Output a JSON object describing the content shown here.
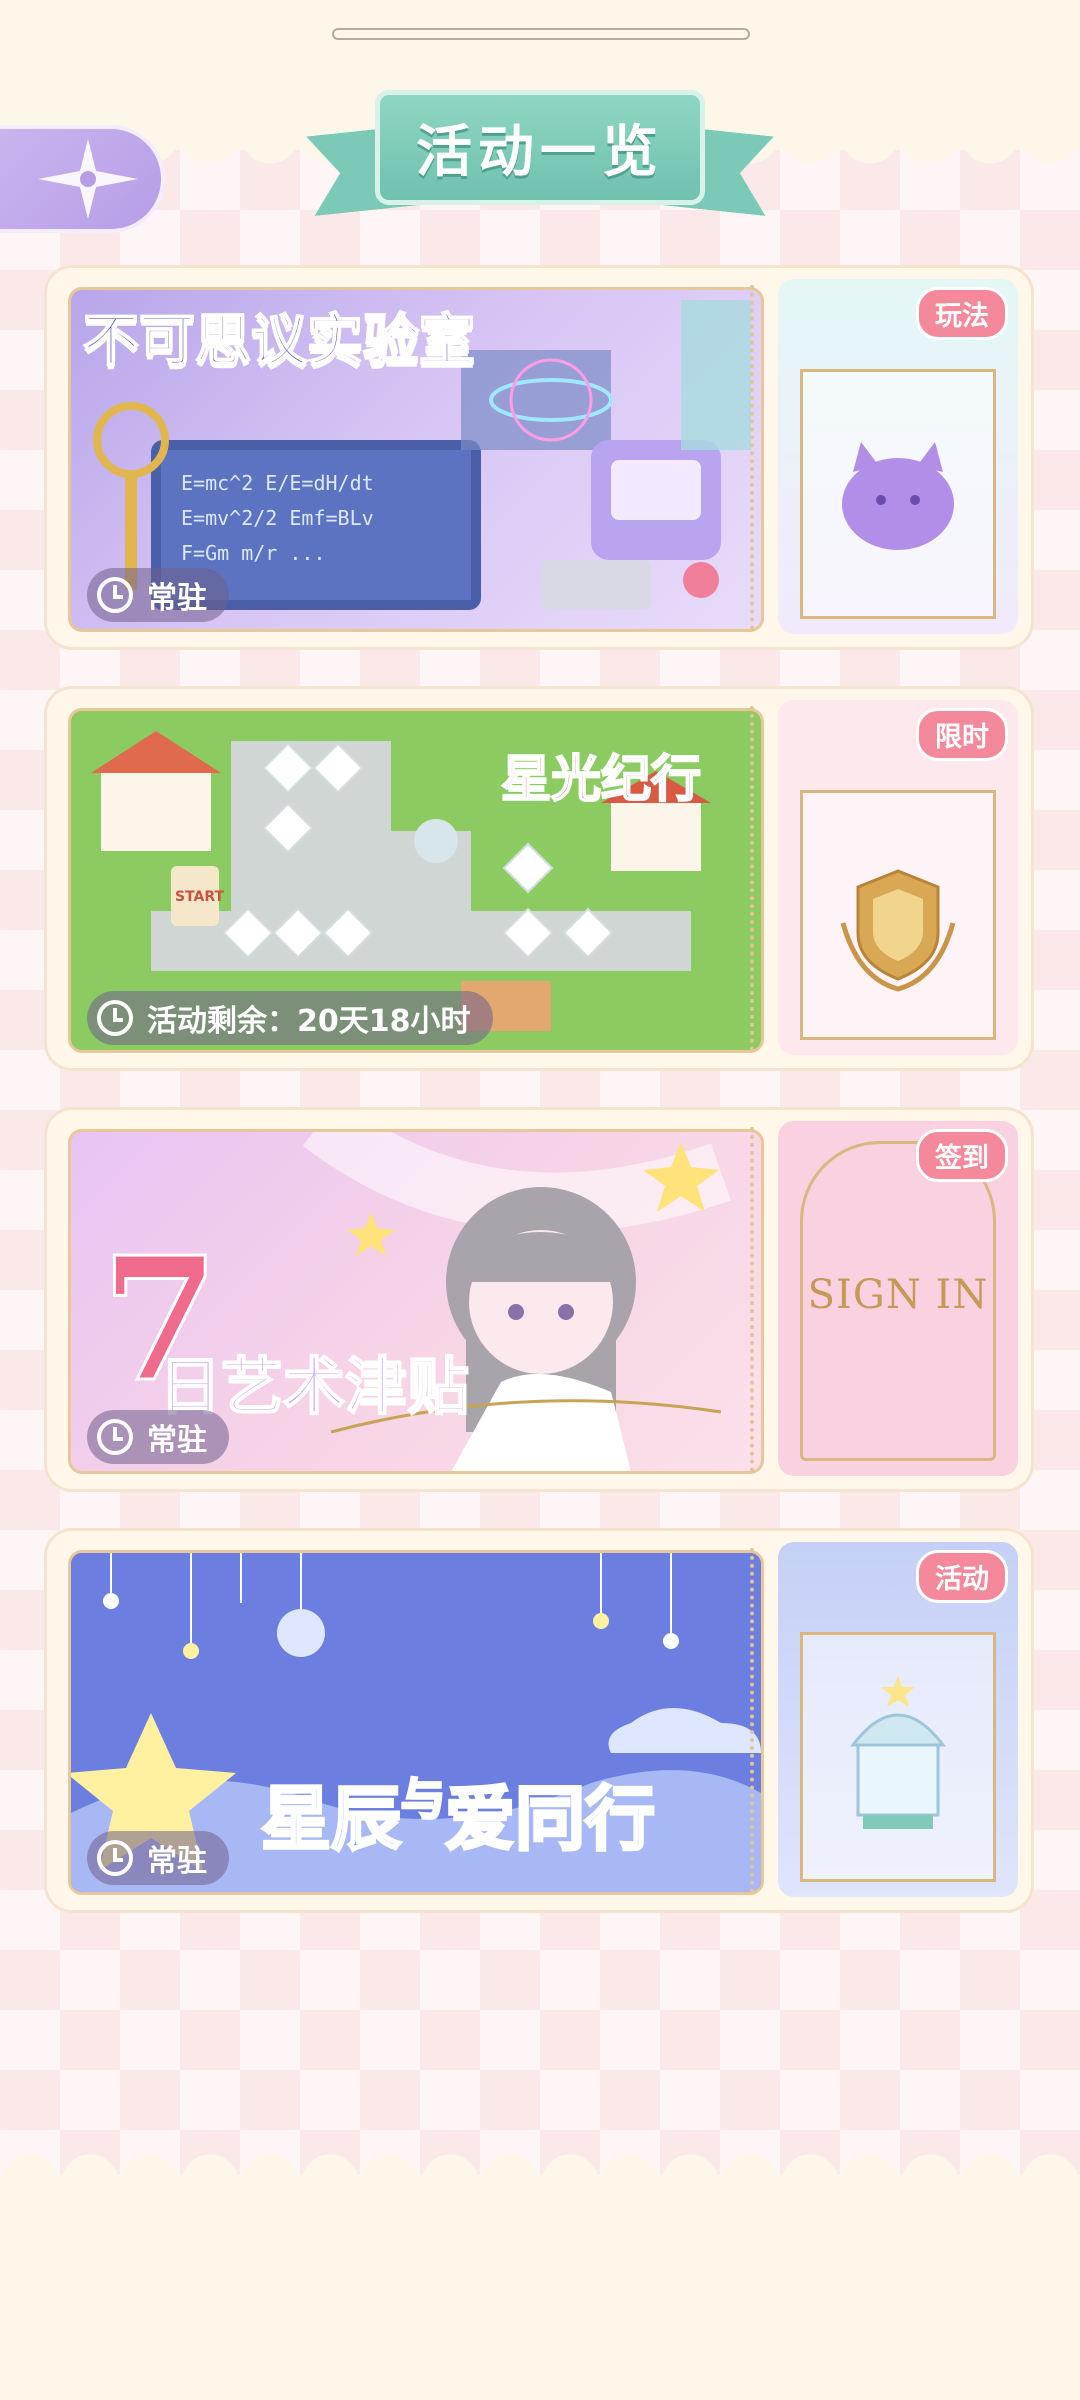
{
  "header": {
    "title": "活动一览",
    "back_icon": "star-compass-icon"
  },
  "activities": [
    {
      "title": "不可思议实验室",
      "status": "常驻",
      "tag": "玩法",
      "stub_icon": "purple-cat-plush-icon",
      "colors": {
        "banner": "#c9b6ee",
        "stub": "#eaf6f6"
      }
    },
    {
      "title": "星光纪行",
      "status": "活动剩余：20天18小时",
      "tag": "限时",
      "board_start": "START",
      "stub_icon": "crest-badge-icon",
      "colors": {
        "banner": "#8cc965",
        "stub": "#fde7ec"
      }
    },
    {
      "title": "7日艺术津贴",
      "title_number": "7",
      "title_rest": "日艺术津贴",
      "status": "常驻",
      "tag": "签到",
      "stub_text": "SIGN IN",
      "colors": {
        "banner": "#f4c9e0",
        "stub": "#f9d3e1"
      }
    },
    {
      "title": "星辰与爱同行",
      "title_parts": [
        "星辰",
        "与",
        "爱",
        "同行"
      ],
      "status": "常驻",
      "tag": "活动",
      "stub_icon": "gazebo-icon",
      "colors": {
        "banner": "#7f95e6",
        "stub": "#cdd6f7"
      }
    }
  ]
}
